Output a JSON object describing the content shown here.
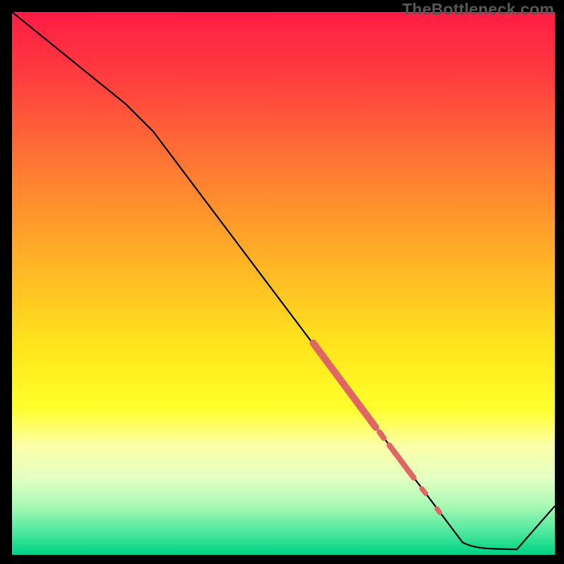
{
  "watermark": "TheBottleneck.com",
  "chart_data": {
    "type": "line",
    "title": "",
    "xlabel": "",
    "ylabel": "",
    "xlim": [
      0,
      100
    ],
    "ylim": [
      0,
      100
    ],
    "gradient_stops": [
      {
        "offset": 0,
        "color": "#ff1c44"
      },
      {
        "offset": 0.12,
        "color": "#ff3d3f"
      },
      {
        "offset": 0.3,
        "color": "#ff7e32"
      },
      {
        "offset": 0.5,
        "color": "#ffc024"
      },
      {
        "offset": 0.62,
        "color": "#ffe61c"
      },
      {
        "offset": 0.73,
        "color": "#ffff2b"
      },
      {
        "offset": 0.8,
        "color": "#fcffa8"
      },
      {
        "offset": 0.86,
        "color": "#e3ffc2"
      },
      {
        "offset": 0.91,
        "color": "#a7f9b3"
      },
      {
        "offset": 0.955,
        "color": "#54e8a0"
      },
      {
        "offset": 0.985,
        "color": "#18da8d"
      },
      {
        "offset": 1.0,
        "color": "#00d186"
      }
    ],
    "series": [
      {
        "name": "bottleneck-curve",
        "points": [
          {
            "x": 0.0,
            "y": 100.0
          },
          {
            "x": 21.0,
            "y": 83.0
          },
          {
            "x": 26.0,
            "y": 78.0
          },
          {
            "x": 83.0,
            "y": 2.3
          },
          {
            "x": 85.0,
            "y": 1.2
          },
          {
            "x": 93.0,
            "y": 1.0
          },
          {
            "x": 100.0,
            "y": 9.0
          }
        ]
      }
    ],
    "highlight_segments": [
      {
        "x1": 55.5,
        "y1": 39.0,
        "x2": 67.0,
        "y2": 23.5,
        "width": 10
      },
      {
        "x1": 67.7,
        "y1": 22.6,
        "x2": 68.5,
        "y2": 21.5,
        "width": 8
      },
      {
        "x1": 69.5,
        "y1": 20.2,
        "x2": 74.0,
        "y2": 14.2,
        "width": 8
      },
      {
        "x1": 75.5,
        "y1": 12.2,
        "x2": 76.2,
        "y2": 11.3,
        "width": 7
      },
      {
        "x1": 78.3,
        "y1": 8.5,
        "x2": 78.8,
        "y2": 7.8,
        "width": 7
      }
    ],
    "highlight_color": "#e06666"
  }
}
